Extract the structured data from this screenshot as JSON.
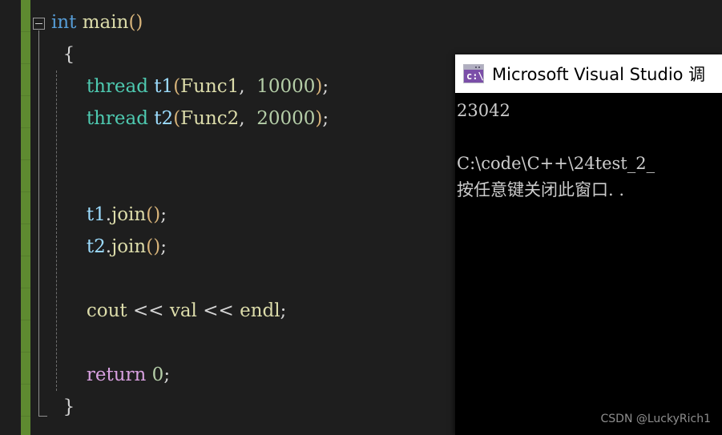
{
  "editor": {
    "background_color": "#1e1e1e",
    "change_bar_color": "#5e8a30",
    "outlining": {
      "collapse_icon": "minus-box-icon",
      "expanded": true
    },
    "code_lines": [
      {
        "id": "line-int-main",
        "tokens": [
          {
            "text": "int",
            "kind": "kw-type"
          },
          {
            "text": " ",
            "kind": "punct"
          },
          {
            "text": "main",
            "kind": "func"
          },
          {
            "text": "()",
            "kind": "paren"
          }
        ]
      },
      {
        "id": "line-open-brace",
        "tokens": [
          {
            "text": "  ",
            "kind": "punct"
          },
          {
            "text": "{",
            "kind": "brace"
          }
        ]
      },
      {
        "id": "line-thread-t1",
        "tokens": [
          {
            "text": "      ",
            "kind": "punct"
          },
          {
            "text": "thread",
            "kind": "cls"
          },
          {
            "text": " ",
            "kind": "punct"
          },
          {
            "text": "t1",
            "kind": "ident"
          },
          {
            "text": "(",
            "kind": "paren"
          },
          {
            "text": "Func1",
            "kind": "func"
          },
          {
            "text": ", ",
            "kind": "punct"
          },
          {
            "text": " 10000",
            "kind": "num"
          },
          {
            "text": ")",
            "kind": "paren"
          },
          {
            "text": ";",
            "kind": "punct"
          }
        ]
      },
      {
        "id": "line-thread-t2",
        "tokens": [
          {
            "text": "      ",
            "kind": "punct"
          },
          {
            "text": "thread",
            "kind": "cls"
          },
          {
            "text": " ",
            "kind": "punct"
          },
          {
            "text": "t2",
            "kind": "ident"
          },
          {
            "text": "(",
            "kind": "paren"
          },
          {
            "text": "Func2",
            "kind": "func"
          },
          {
            "text": ", ",
            "kind": "punct"
          },
          {
            "text": " 20000",
            "kind": "num"
          },
          {
            "text": ")",
            "kind": "paren"
          },
          {
            "text": ";",
            "kind": "punct"
          }
        ]
      },
      {
        "id": "line-blank-1",
        "tokens": []
      },
      {
        "id": "line-blank-2",
        "tokens": []
      },
      {
        "id": "line-t1-join",
        "tokens": [
          {
            "text": "      ",
            "kind": "punct"
          },
          {
            "text": "t1",
            "kind": "ident"
          },
          {
            "text": ".",
            "kind": "punct"
          },
          {
            "text": "join",
            "kind": "func"
          },
          {
            "text": "()",
            "kind": "paren"
          },
          {
            "text": ";",
            "kind": "punct"
          }
        ]
      },
      {
        "id": "line-t2-join",
        "tokens": [
          {
            "text": "      ",
            "kind": "punct"
          },
          {
            "text": "t2",
            "kind": "ident"
          },
          {
            "text": ".",
            "kind": "punct"
          },
          {
            "text": "join",
            "kind": "func"
          },
          {
            "text": "()",
            "kind": "paren"
          },
          {
            "text": ";",
            "kind": "punct"
          }
        ]
      },
      {
        "id": "line-blank-3",
        "tokens": []
      },
      {
        "id": "line-cout",
        "tokens": [
          {
            "text": "      ",
            "kind": "punct"
          },
          {
            "text": "cout",
            "kind": "func"
          },
          {
            "text": " << ",
            "kind": "punct"
          },
          {
            "text": "val",
            "kind": "func"
          },
          {
            "text": " << ",
            "kind": "punct"
          },
          {
            "text": "endl",
            "kind": "func"
          },
          {
            "text": ";",
            "kind": "punct"
          }
        ]
      },
      {
        "id": "line-blank-4",
        "tokens": []
      },
      {
        "id": "line-return",
        "tokens": [
          {
            "text": "      ",
            "kind": "punct"
          },
          {
            "text": "return",
            "kind": "kw-ctrl"
          },
          {
            "text": " ",
            "kind": "punct"
          },
          {
            "text": "0",
            "kind": "num"
          },
          {
            "text": ";",
            "kind": "punct"
          }
        ]
      },
      {
        "id": "line-close-brace",
        "tokens": [
          {
            "text": "  ",
            "kind": "punct"
          },
          {
            "text": "}",
            "kind": "brace"
          }
        ]
      }
    ]
  },
  "console": {
    "icon_name": "command-prompt-icon",
    "icon_glyph": "c:\\",
    "title": "Microsoft Visual Studio 调",
    "output_lines": [
      "23042",
      "",
      "C:\\code\\C++\\24test_2_",
      "按任意键关闭此窗口. ."
    ]
  },
  "watermark": {
    "text": "CSDN @LuckyRich1"
  }
}
